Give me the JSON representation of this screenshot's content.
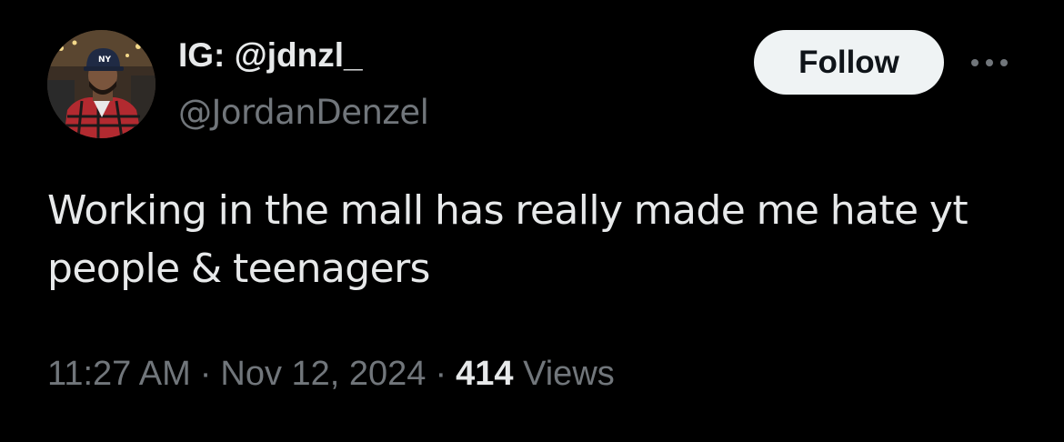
{
  "author": {
    "display_name": "IG: @jdnzl_",
    "handle": "@JordanDenzel",
    "avatar_icon": "profile-photo"
  },
  "follow_button": {
    "label": "Follow"
  },
  "more_button": {
    "icon": "more-horizontal-icon"
  },
  "tweet": {
    "text": "Working in the mall has really made me hate yt people & teenagers"
  },
  "meta": {
    "time": "11:27 AM",
    "separator": "·",
    "date": "Nov 12, 2024",
    "views_count": "414",
    "views_label": "Views"
  },
  "colors": {
    "background": "#000000",
    "primary_text": "#e7e9ea",
    "secondary_text": "#71767b",
    "follow_bg": "#eff3f4",
    "follow_text": "#0f1419"
  }
}
